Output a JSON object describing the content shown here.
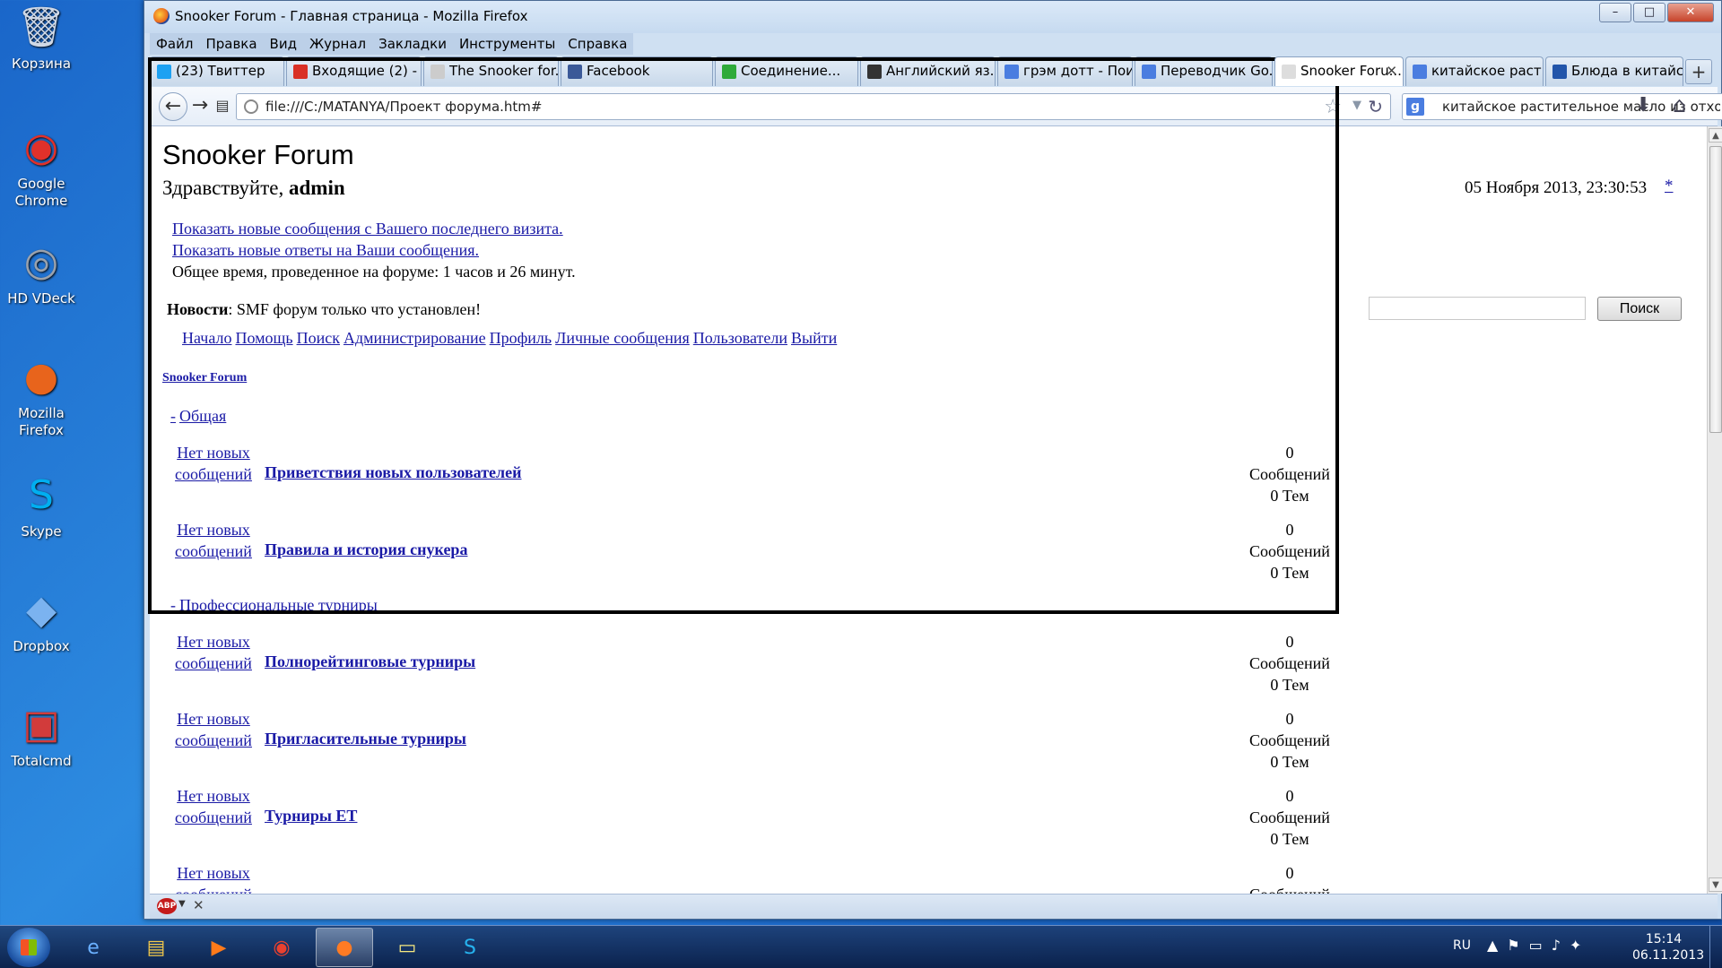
{
  "desktop": {
    "icons": [
      {
        "label": "Корзина",
        "icon": "recycle-bin-icon"
      },
      {
        "label": "Google Chrome",
        "icon": "chrome-icon"
      },
      {
        "label": "HD VDeck",
        "icon": "hd-vdeck-icon"
      },
      {
        "label": "Mozilla Firefox",
        "icon": "firefox-icon"
      },
      {
        "label": "Skype",
        "icon": "skype-icon"
      },
      {
        "label": "Dropbox",
        "icon": "dropbox-icon"
      },
      {
        "label": "Totalcmd",
        "icon": "totalcmd-icon"
      }
    ]
  },
  "window": {
    "title": "Snooker Forum - Главная страница - Mozilla Firefox",
    "controls": {
      "minimize": "–",
      "maximize": "□",
      "close": "✕"
    }
  },
  "menu": [
    "Файл",
    "Правка",
    "Вид",
    "Журнал",
    "Закладки",
    "Инструменты",
    "Справка"
  ],
  "tabs": [
    {
      "label": "(23) Твиттер",
      "icon_color": "#1da1f2"
    },
    {
      "label": "Входящие (2) - ...",
      "icon_color": "#d93025"
    },
    {
      "label": "The Snooker for...",
      "icon_color": "#cccccc"
    },
    {
      "label": "Facebook",
      "icon_color": "#3b5998"
    },
    {
      "label": "Соединение...",
      "icon_color": "#2eaa3a"
    },
    {
      "label": "Английский яз...",
      "icon_color": "#333333"
    },
    {
      "label": "грэм дотт - Пои...",
      "icon_color": "#4a7de0"
    },
    {
      "label": "Переводчик Go...",
      "icon_color": "#4a7de0"
    },
    {
      "label": "Snooker Foru...",
      "icon_color": "#dddddd",
      "active": true
    },
    {
      "label": "китайское раст...",
      "icon_color": "#4a7de0"
    },
    {
      "label": "Блюда в китайс...",
      "icon_color": "#2255aa"
    }
  ],
  "navbar": {
    "url": "file:///C:/MATANYA/Проект форума.htm#",
    "search_value": "китайское растительное масло из отходов",
    "search_engine_glyph": "g"
  },
  "page": {
    "site_title": "Snooker Forum",
    "greeting": "Здравствуйте,",
    "username": "admin",
    "datetime": "05 Ноября 2013, 23:30:53",
    "datetime_link": "*",
    "show_new_posts": "Показать новые сообщения с Вашего последнего визита.",
    "show_new_replies": "Показать новые ответы на Ваши сообщения.",
    "total_time": "Общее время, проведенное на форуме: 1 часов и 26 минут.",
    "news_label": "Новости",
    "news_text": ": SMF форум только что установлен!",
    "search_button": "Поиск",
    "menu_links": [
      "Начало",
      "Помощь",
      "Поиск",
      "Администрирование",
      "Профиль",
      "Личные сообщения",
      "Пользователи",
      "Выйти"
    ],
    "forum_link": "Snooker Forum",
    "no_new_line1": "Нет новых",
    "no_new_line2": "сообщений",
    "messages_word": "Сообщений",
    "categories": [
      {
        "collapse": "-",
        "name": "Общая",
        "boards": [
          {
            "name": "Приветствия новых пользователей",
            "posts": "0",
            "topics": "0 Тем"
          },
          {
            "name": "Правила и история снукера",
            "posts": "0",
            "topics": "0 Тем"
          }
        ]
      },
      {
        "collapse": "-",
        "name": "Профессиональные турниры",
        "boards": [
          {
            "name": "Полнорейтинговые турниры",
            "posts": "0",
            "topics": "0 Тем"
          },
          {
            "name": "Пригласительные турниры",
            "posts": "0",
            "topics": "0 Тем"
          },
          {
            "name": "Турниры ET",
            "posts": "0",
            "topics": "0 Тем"
          },
          {
            "name": "",
            "posts": "0",
            "topics": ""
          }
        ]
      }
    ]
  },
  "taskbar": {
    "items": [
      "explorer-icon",
      "ie-icon",
      "file-explorer-icon",
      "media-player-icon",
      "chrome-icon",
      "firefox-icon",
      "sticky-notes-icon",
      "skype-icon"
    ],
    "lang": "RU",
    "time": "15:14",
    "date": "06.11.2013"
  }
}
